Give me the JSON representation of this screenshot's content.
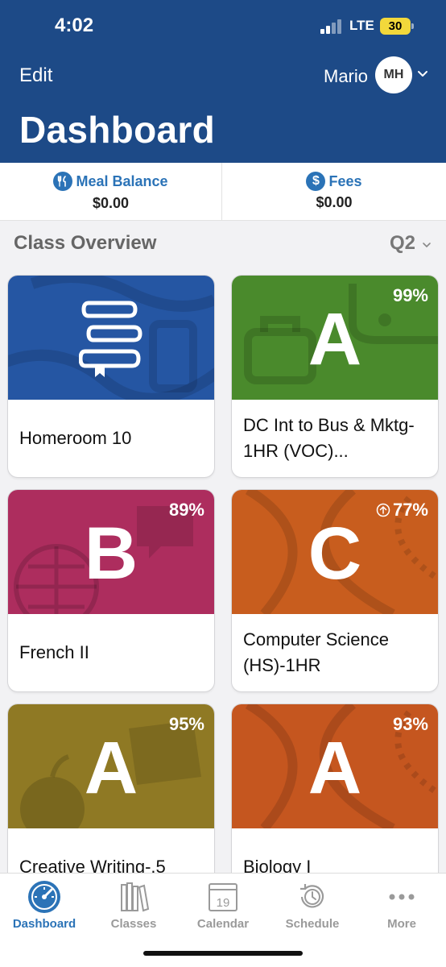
{
  "status_bar": {
    "time": "4:02",
    "network": "LTE",
    "battery": "30"
  },
  "header": {
    "edit_label": "Edit",
    "user_name": "Mario",
    "user_initials": "MH",
    "title": "Dashboard"
  },
  "balances": {
    "meal": {
      "label": "Meal Balance",
      "value": "$0.00",
      "icon": "utensils-icon"
    },
    "fees": {
      "label": "Fees",
      "value": "$0.00",
      "icon": "dollar-icon",
      "icon_glyph": "$"
    }
  },
  "overview": {
    "title": "Class Overview",
    "quarter": "Q2"
  },
  "classes": [
    {
      "name": "Homeroom 10",
      "grade": "",
      "percent": "",
      "color": "#2556a3",
      "icon": "books-icon"
    },
    {
      "name": "DC Int to Bus & Mktg-1HR (VOC)...",
      "grade": "A",
      "percent": "99%",
      "color": "#4a8a2c"
    },
    {
      "name": "French II",
      "grade": "B",
      "percent": "89%",
      "color": "#ad2d5e"
    },
    {
      "name": "Computer Science (HS)-1HR",
      "grade": "C",
      "percent": "77%",
      "color": "#c85d1e",
      "trend_icon": "arrow-up-circle-icon"
    },
    {
      "name": "Creative Writing-.5",
      "grade": "A",
      "percent": "95%",
      "color": "#8f7924"
    },
    {
      "name": "Biology I",
      "grade": "A",
      "percent": "93%",
      "color": "#c5561f"
    }
  ],
  "tabs": [
    {
      "label": "Dashboard",
      "icon": "gauge-icon",
      "active": true
    },
    {
      "label": "Classes",
      "icon": "books-icon"
    },
    {
      "label": "Calendar",
      "icon": "calendar-icon",
      "icon_text": "19"
    },
    {
      "label": "Schedule",
      "icon": "clock-icon"
    },
    {
      "label": "More",
      "icon": "more-dots-icon"
    }
  ],
  "colors": {
    "header": "#1d4a87",
    "accent": "#2b73b7",
    "inactive_tab": "#9a9a9a"
  }
}
